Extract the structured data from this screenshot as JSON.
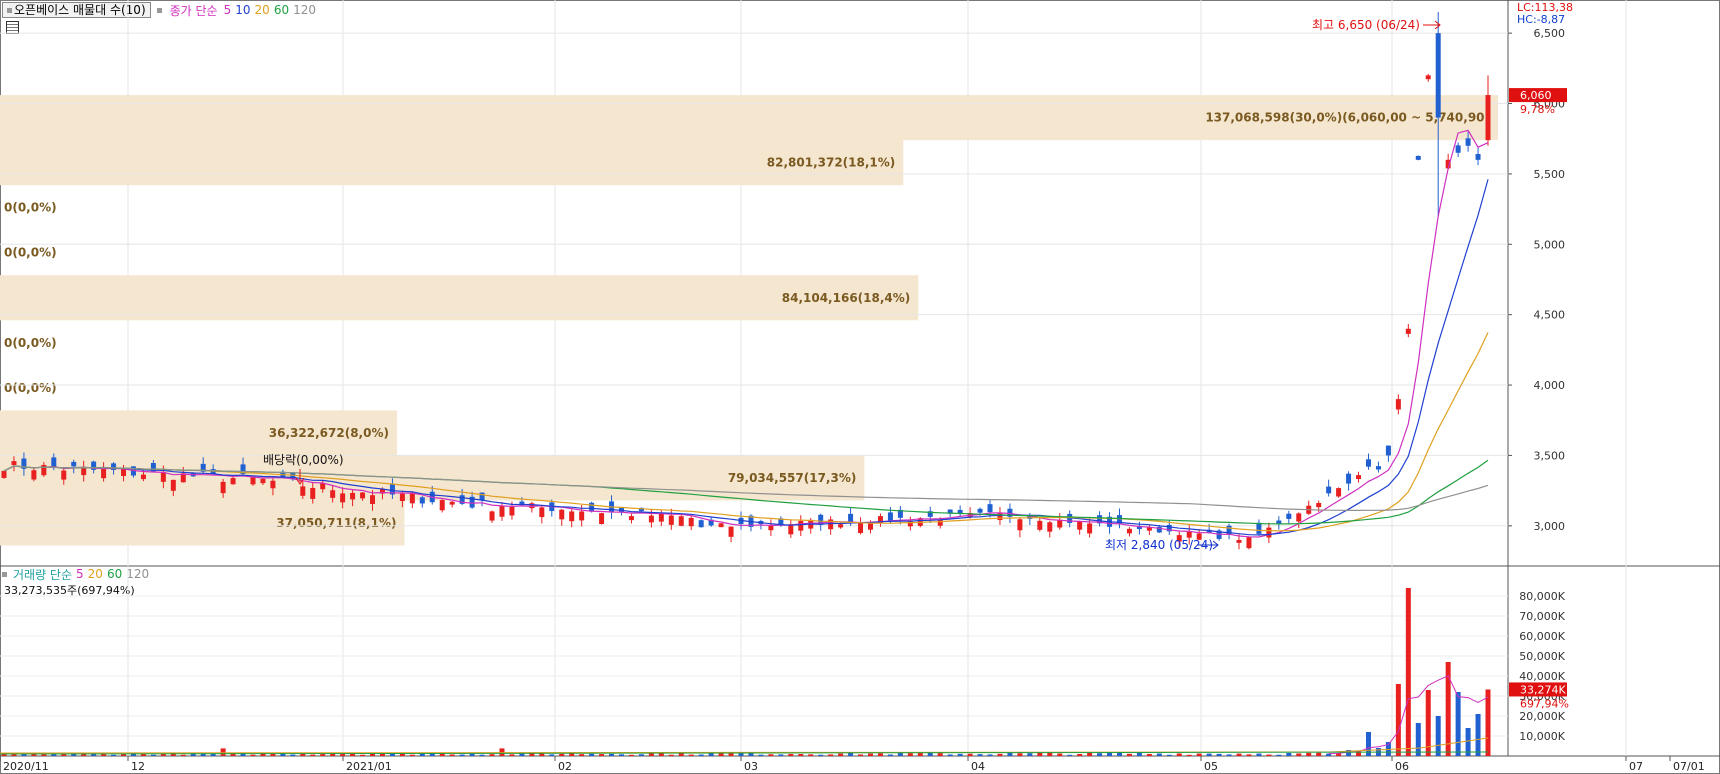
{
  "indicator_bar": {
    "main_title": "오픈베이스 매물대 수(10)",
    "ma_label": "종가 단순",
    "ma_periods": [
      "5",
      "10",
      "20",
      "60",
      "120"
    ],
    "ma_colors": [
      "#d030c0",
      "#2040d0",
      "#e0a020",
      "#20a040",
      "#909090"
    ]
  },
  "volume_bar": {
    "title": "거래량 단순",
    "periods": [
      "5",
      "20",
      "60",
      "120"
    ],
    "colors": [
      "#d030c0",
      "#e0a020",
      "#20a040",
      "#909090"
    ],
    "current": "33,273,535주(697,94%)"
  },
  "right_axis": {
    "lc": "LC:113,38",
    "hc": "HC:-8,87",
    "last_price": "6,060",
    "last_change": "9,78%",
    "last_volume": "33,274K",
    "last_volume_pct": "697,94%"
  },
  "annotations": {
    "high": "최고 6,650 (06/24)",
    "low": "최저 2,840 (05/24)",
    "dividend": "배당락(0,00%)"
  },
  "colors": {
    "up": "#e82020",
    "down": "#2060d0",
    "profile": "#f5e6d0",
    "profile_text": "#7a5a20"
  },
  "chart_data": [
    {
      "type": "candlestick",
      "ylim": [
        2750,
        6700
      ],
      "y_ticks": [
        "3,000",
        "3,500",
        "4,000",
        "4,500",
        "5,000",
        "5,500",
        "6,000",
        "6,500"
      ],
      "x_ticks": [
        "2020/11",
        "12",
        "2021/01",
        "02",
        "03",
        "04",
        "05",
        "06",
        "07",
        "07/01"
      ],
      "moving_averages": [
        "5",
        "10",
        "20",
        "60",
        "120"
      ],
      "volume_profile": [
        {
          "label": "137,068,598(30,0%)(6,060,00 ~ 5,740,90)",
          "price_low": 5740,
          "price_high": 6060,
          "extent": 1.0
        },
        {
          "label": "82,801,372(18,1%)",
          "price_low": 5420,
          "price_high": 5740,
          "extent": 0.603
        },
        {
          "label": "0(0,0%)",
          "price_low": 5100,
          "price_high": 5420,
          "extent": 0
        },
        {
          "label": "0(0,0%)",
          "price_low": 4780,
          "price_high": 5100,
          "extent": 0
        },
        {
          "label": "84,104,166(18,4%)",
          "price_low": 4460,
          "price_high": 4780,
          "extent": 0.613
        },
        {
          "label": "0(0,0%)",
          "price_low": 4140,
          "price_high": 4460,
          "extent": 0
        },
        {
          "label": "0(0,0%)",
          "price_low": 3820,
          "price_high": 4140,
          "extent": 0
        },
        {
          "label": "36,322,672(8,0%)",
          "price_low": 3500,
          "price_high": 3820,
          "extent": 0.265
        },
        {
          "label": "79,034,557(17,3%)",
          "price_low": 3180,
          "price_high": 3500,
          "extent": 0.577
        },
        {
          "label": "37,050,711(8,1%)",
          "price_low": 2860,
          "price_high": 3180,
          "extent": 0.27
        }
      ]
    },
    {
      "type": "bar",
      "title": "거래량",
      "y_ticks": [
        "10,000K",
        "20,000K",
        "30,000K",
        "40,000K",
        "50,000K",
        "60,000K",
        "70,000K",
        "80,000K"
      ],
      "ylim": [
        0,
        85000
      ],
      "recent_values_k": [
        1200,
        1500,
        3000,
        2500,
        12000,
        4000,
        7000,
        36000,
        84000,
        16500,
        33000,
        20000,
        47000,
        32000,
        14000,
        21000,
        33274
      ]
    }
  ]
}
